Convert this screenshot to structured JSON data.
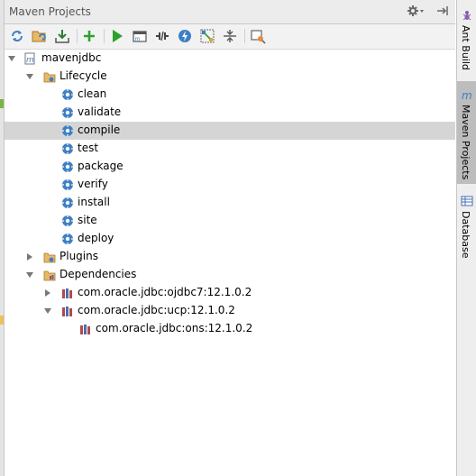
{
  "panel": {
    "title": "Maven Projects"
  },
  "toolbar": {
    "buttons": [
      "reimport-icon",
      "generate-sources-icon",
      "download-icon",
      "add-icon",
      "run-icon",
      "execute-goal-icon",
      "toggle-offline-icon",
      "skip-tests-icon",
      "show-dependencies-icon",
      "collapse-all-icon",
      "settings-icon"
    ]
  },
  "tree": {
    "project": "mavenjdbc",
    "lifecycle": {
      "label": "Lifecycle",
      "goals": [
        "clean",
        "validate",
        "compile",
        "test",
        "package",
        "verify",
        "install",
        "site",
        "deploy"
      ],
      "selected": "compile"
    },
    "plugins": "Plugins",
    "dependencies": {
      "label": "Dependencies",
      "items": [
        "com.oracle.jdbc:ojdbc7:12.1.0.2",
        "com.oracle.jdbc:ucp:12.1.0.2"
      ],
      "child": "com.oracle.jdbc:ons:12.1.0.2"
    }
  },
  "sidebar": {
    "tabs": [
      "Ant Build",
      "Maven Projects",
      "Database"
    ],
    "active": "Maven Projects"
  },
  "colors": {
    "accent": "#3d7fc4",
    "selection": "#d5d5d5",
    "run": "#2ea02e"
  }
}
